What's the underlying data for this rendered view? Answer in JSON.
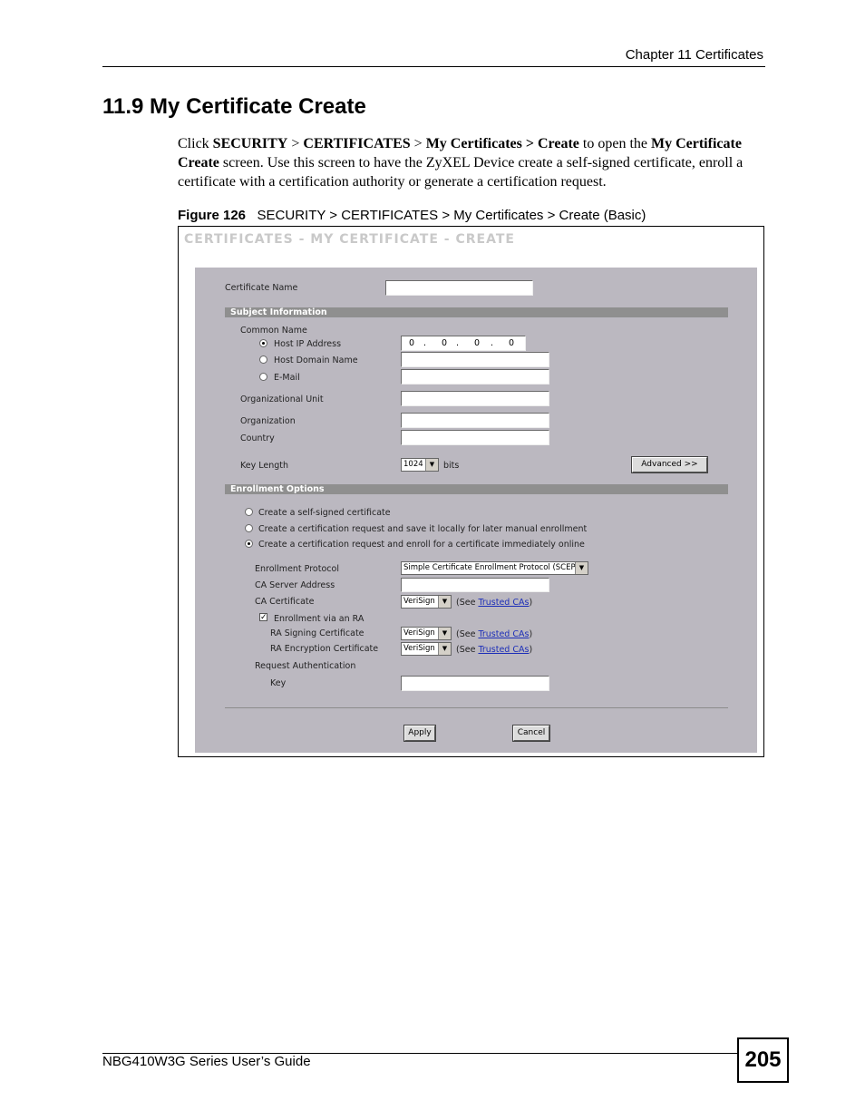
{
  "header": {
    "chapter": "Chapter 11 Certificates"
  },
  "section": {
    "title": "11.9  My Certificate Create"
  },
  "paragraph": {
    "t1": "Click ",
    "b1": "SECURITY",
    "t2": " > ",
    "b2": "CERTIFICATES",
    "t3": " > ",
    "b3": "My Certificates > Create",
    "t4": " to open the ",
    "b4": "My Certificate Create",
    "t5": " screen. Use this screen to have the ZyXEL Device create a self-signed certificate, enroll a certificate with a certification authority or generate a certification request."
  },
  "figure": {
    "label": "Figure 126",
    "caption": "   SECURITY > CERTIFICATES > My Certificates > Create (Basic)"
  },
  "screen": {
    "title": "CERTIFICATES - MY CERTIFICATE - CREATE",
    "certificate_name_label": "Certificate Name",
    "subject_bar": "Subject Information",
    "common_name_label": "Common Name",
    "host_ip_label": "Host IP Address",
    "ip_octets": [
      "0",
      "0",
      "0",
      "0"
    ],
    "ip_dot": ".",
    "host_domain_label": "Host Domain Name",
    "email_label": "E-Mail",
    "org_unit_label": "Organizational Unit",
    "organization_label": "Organization",
    "country_label": "Country",
    "key_length_label": "Key Length",
    "key_length_value": "1024",
    "key_length_unit": "bits",
    "advanced_button": "Advanced >>",
    "enrollment_bar": "Enrollment Options",
    "opt_self_signed": "Create a self-signed certificate",
    "opt_save_local": "Create a certification request and save it locally for later manual enrollment",
    "opt_enroll_online": "Create a certification request and enroll for a certificate immediately online",
    "enroll_protocol_label": "Enrollment Protocol",
    "enroll_protocol_value": "Simple Certificate Enrollment Protocol (SCEP)",
    "ca_server_label": "CA Server Address",
    "ca_cert_label": "CA Certificate",
    "ca_cert_value": "VeriSign",
    "see_open": "(See ",
    "trusted_cas": "Trusted CAs",
    "see_close": ")",
    "enroll_ra_label": "Enrollment via an RA",
    "ra_signing_label": "RA Signing Certificate",
    "ra_signing_value": "VeriSign",
    "ra_encryption_label": "RA Encryption Certificate",
    "ra_encryption_value": "VeriSign",
    "request_auth_label": "Request Authentication",
    "key_label": "Key",
    "apply_button": "Apply",
    "cancel_button": "Cancel"
  },
  "footer": {
    "guide": "NBG410W3G Series User’s Guide",
    "page_number": "205"
  }
}
